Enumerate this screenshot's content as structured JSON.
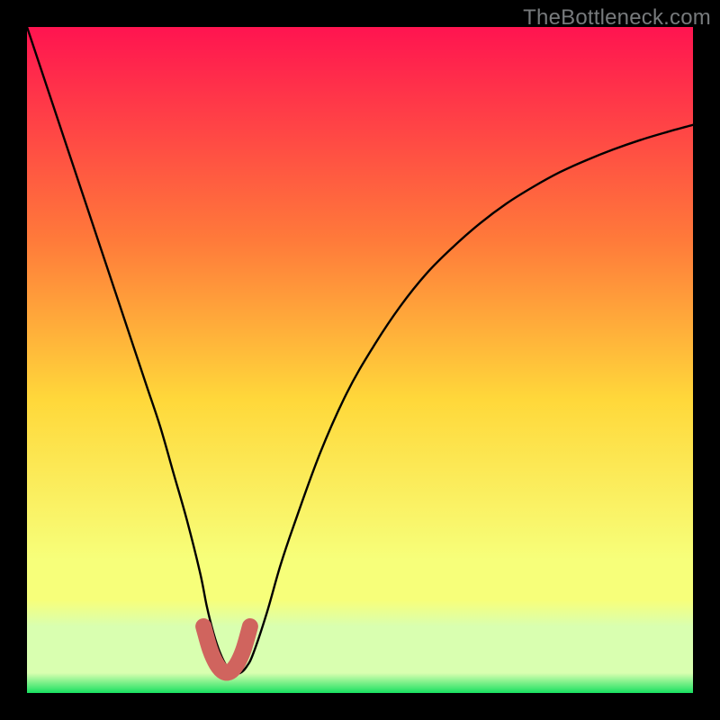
{
  "watermark": "TheBottleneck.com",
  "chart_data": {
    "type": "line",
    "title": "",
    "xlabel": "",
    "ylabel": "",
    "xlim": [
      0,
      100
    ],
    "ylim": [
      0,
      100
    ],
    "grid": false,
    "legend": false,
    "colors": {
      "gradient_top": "#ff1450",
      "gradient_mid_upper": "#ff7a3a",
      "gradient_mid": "#ffd83a",
      "gradient_lower": "#f7ff7a",
      "gradient_band": "#d9ffb0",
      "gradient_bottom": "#18e060",
      "curve": "#000000",
      "highlight": "#d0645e"
    },
    "series": [
      {
        "name": "bottleneck-curve",
        "x": [
          0,
          2,
          4,
          6,
          8,
          10,
          12,
          14,
          16,
          18,
          20,
          22,
          24,
          26,
          27,
          28,
          29,
          30,
          31,
          32,
          33,
          34,
          36,
          38,
          40,
          44,
          48,
          52,
          56,
          60,
          64,
          68,
          72,
          76,
          80,
          84,
          88,
          92,
          96,
          100
        ],
        "values": [
          100,
          94,
          88,
          82,
          76,
          70,
          64,
          58,
          52,
          46,
          40,
          33,
          26,
          18,
          13,
          9,
          6,
          4,
          3,
          3,
          4,
          6,
          12,
          19,
          25,
          36,
          45,
          52,
          58,
          63,
          67,
          70.5,
          73.5,
          76,
          78.2,
          80,
          81.6,
          83,
          84.2,
          85.3
        ]
      }
    ],
    "highlight_segment": {
      "x": [
        26.5,
        27.5,
        28.5,
        29.5,
        30.5,
        31.5,
        32.5,
        33.5
      ],
      "values": [
        10,
        6.5,
        4.3,
        3.2,
        3.2,
        4.3,
        6.5,
        10
      ]
    },
    "annotations": []
  }
}
